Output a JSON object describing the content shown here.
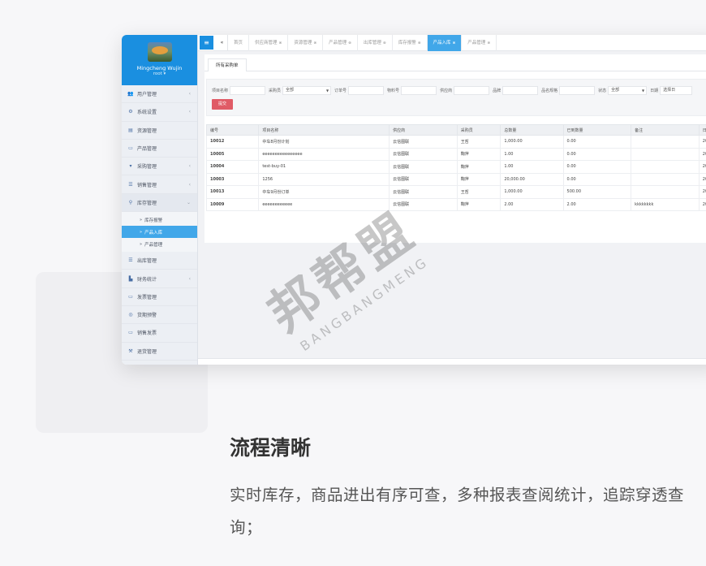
{
  "sidebar": {
    "user_name": "Mingcheng Wujin",
    "user_role": "root ▾",
    "items": [
      {
        "label": "用户管理",
        "icon": "users-icon",
        "glyph": "👥",
        "arrow": "‹"
      },
      {
        "label": "系统设置",
        "icon": "gear-icon",
        "glyph": "⚙",
        "arrow": "‹"
      },
      {
        "label": "资源管理",
        "icon": "file-icon",
        "glyph": "▤",
        "arrow": ""
      },
      {
        "label": "产品管理",
        "icon": "monitor-icon",
        "glyph": "▭",
        "arrow": ""
      },
      {
        "label": "采购管理",
        "icon": "cart-icon",
        "glyph": "▾",
        "arrow": "‹"
      },
      {
        "label": "销售管理",
        "icon": "list-icon",
        "glyph": "☰",
        "arrow": "‹"
      },
      {
        "label": "库存管理",
        "icon": "sitemap-icon",
        "glyph": "⚲",
        "arrow": "⌄"
      }
    ],
    "sub_items": [
      {
        "label": "库存报警",
        "active": false
      },
      {
        "label": "产品入库",
        "active": true
      },
      {
        "label": "产品管理",
        "active": false
      }
    ],
    "items_after": [
      {
        "label": "出库管理",
        "icon": "list-icon",
        "glyph": "☰",
        "arrow": ""
      },
      {
        "label": "财务统计",
        "icon": "chart-icon",
        "glyph": "▙",
        "arrow": "‹"
      },
      {
        "label": "发票管理",
        "icon": "monitor-icon",
        "glyph": "▭",
        "arrow": ""
      },
      {
        "label": "货期预警",
        "icon": "dashboard-icon",
        "glyph": "◎",
        "arrow": ""
      },
      {
        "label": "销售发票",
        "icon": "monitor-icon",
        "glyph": "▭",
        "arrow": ""
      },
      {
        "label": "退货管理",
        "icon": "gavel-icon",
        "glyph": "⚒",
        "arrow": ""
      }
    ]
  },
  "tabbar": {
    "menu_glyph": "≡",
    "back_glyph": "«",
    "tabs": [
      {
        "label": "首页",
        "active": false,
        "closable": false
      },
      {
        "label": "供应商管理",
        "active": false,
        "closable": true
      },
      {
        "label": "资源管理",
        "active": false,
        "closable": true
      },
      {
        "label": "产品管理",
        "active": false,
        "closable": true
      },
      {
        "label": "出库管理",
        "active": false,
        "closable": true
      },
      {
        "label": "库存报警",
        "active": false,
        "closable": true
      },
      {
        "label": "产品入库",
        "active": true,
        "closable": true
      },
      {
        "label": "产品管理",
        "active": false,
        "closable": true
      }
    ],
    "close_glyph": "⊗"
  },
  "panel": {
    "subtab": "所有采购单"
  },
  "filter": {
    "fields": [
      {
        "label": "项目名称",
        "value": "",
        "width": 44,
        "select": false
      },
      {
        "label": "采购员",
        "value": "全部",
        "width": 60,
        "select": true
      },
      {
        "label": "订单号",
        "value": "",
        "width": 44,
        "select": false
      },
      {
        "label": "物料号",
        "value": "",
        "width": 44,
        "select": false
      },
      {
        "label": "供应商",
        "value": "",
        "width": 44,
        "select": false
      },
      {
        "label": "品牌",
        "value": "",
        "width": 44,
        "select": false
      },
      {
        "label": "品名规格",
        "value": "",
        "width": 44,
        "select": false
      },
      {
        "label": "状态",
        "value": "全部",
        "width": 48,
        "select": true
      },
      {
        "label": "日期",
        "value": "选择日",
        "width": 40,
        "select": false
      }
    ],
    "submit_label": "提交"
  },
  "table": {
    "headers": [
      "编号",
      "项目名称",
      "供应商",
      "采购员",
      "总数量",
      "已到数量",
      "备注",
      "日"
    ],
    "rows": [
      [
        "10012",
        "中车8月份计划",
        "云信图联",
        "王哲",
        "1,000.00",
        "0.00",
        "",
        "20"
      ],
      [
        "10005",
        "eeeeeeeeeeeeeeee",
        "云信图联",
        "鞠萍",
        "1.00",
        "0.00",
        "",
        "20"
      ],
      [
        "10004",
        "test-buy-01",
        "云信图联",
        "鞠萍",
        "1.00",
        "0.00",
        "",
        "20"
      ],
      [
        "10003",
        "1256",
        "云信图联",
        "鞠萍",
        "20,000.00",
        "0.00",
        "",
        "20"
      ],
      [
        "10013",
        "中车9月份订单",
        "云信图联",
        "王哲",
        "1,000.00",
        "500.00",
        "",
        "20"
      ],
      [
        "10009",
        "eeeeeeeeeeee",
        "云信图联",
        "鞠萍",
        "2.00",
        "2.00",
        "kkkkkkkk",
        "20"
      ]
    ]
  },
  "watermark": {
    "cn": "邦帮盟",
    "en": "BANGBANGMENG"
  },
  "caption": {
    "title": "流程清晰",
    "desc": "实时库存，商品进出有序可查，多种报表查阅统计，追踪穿透查询；"
  }
}
